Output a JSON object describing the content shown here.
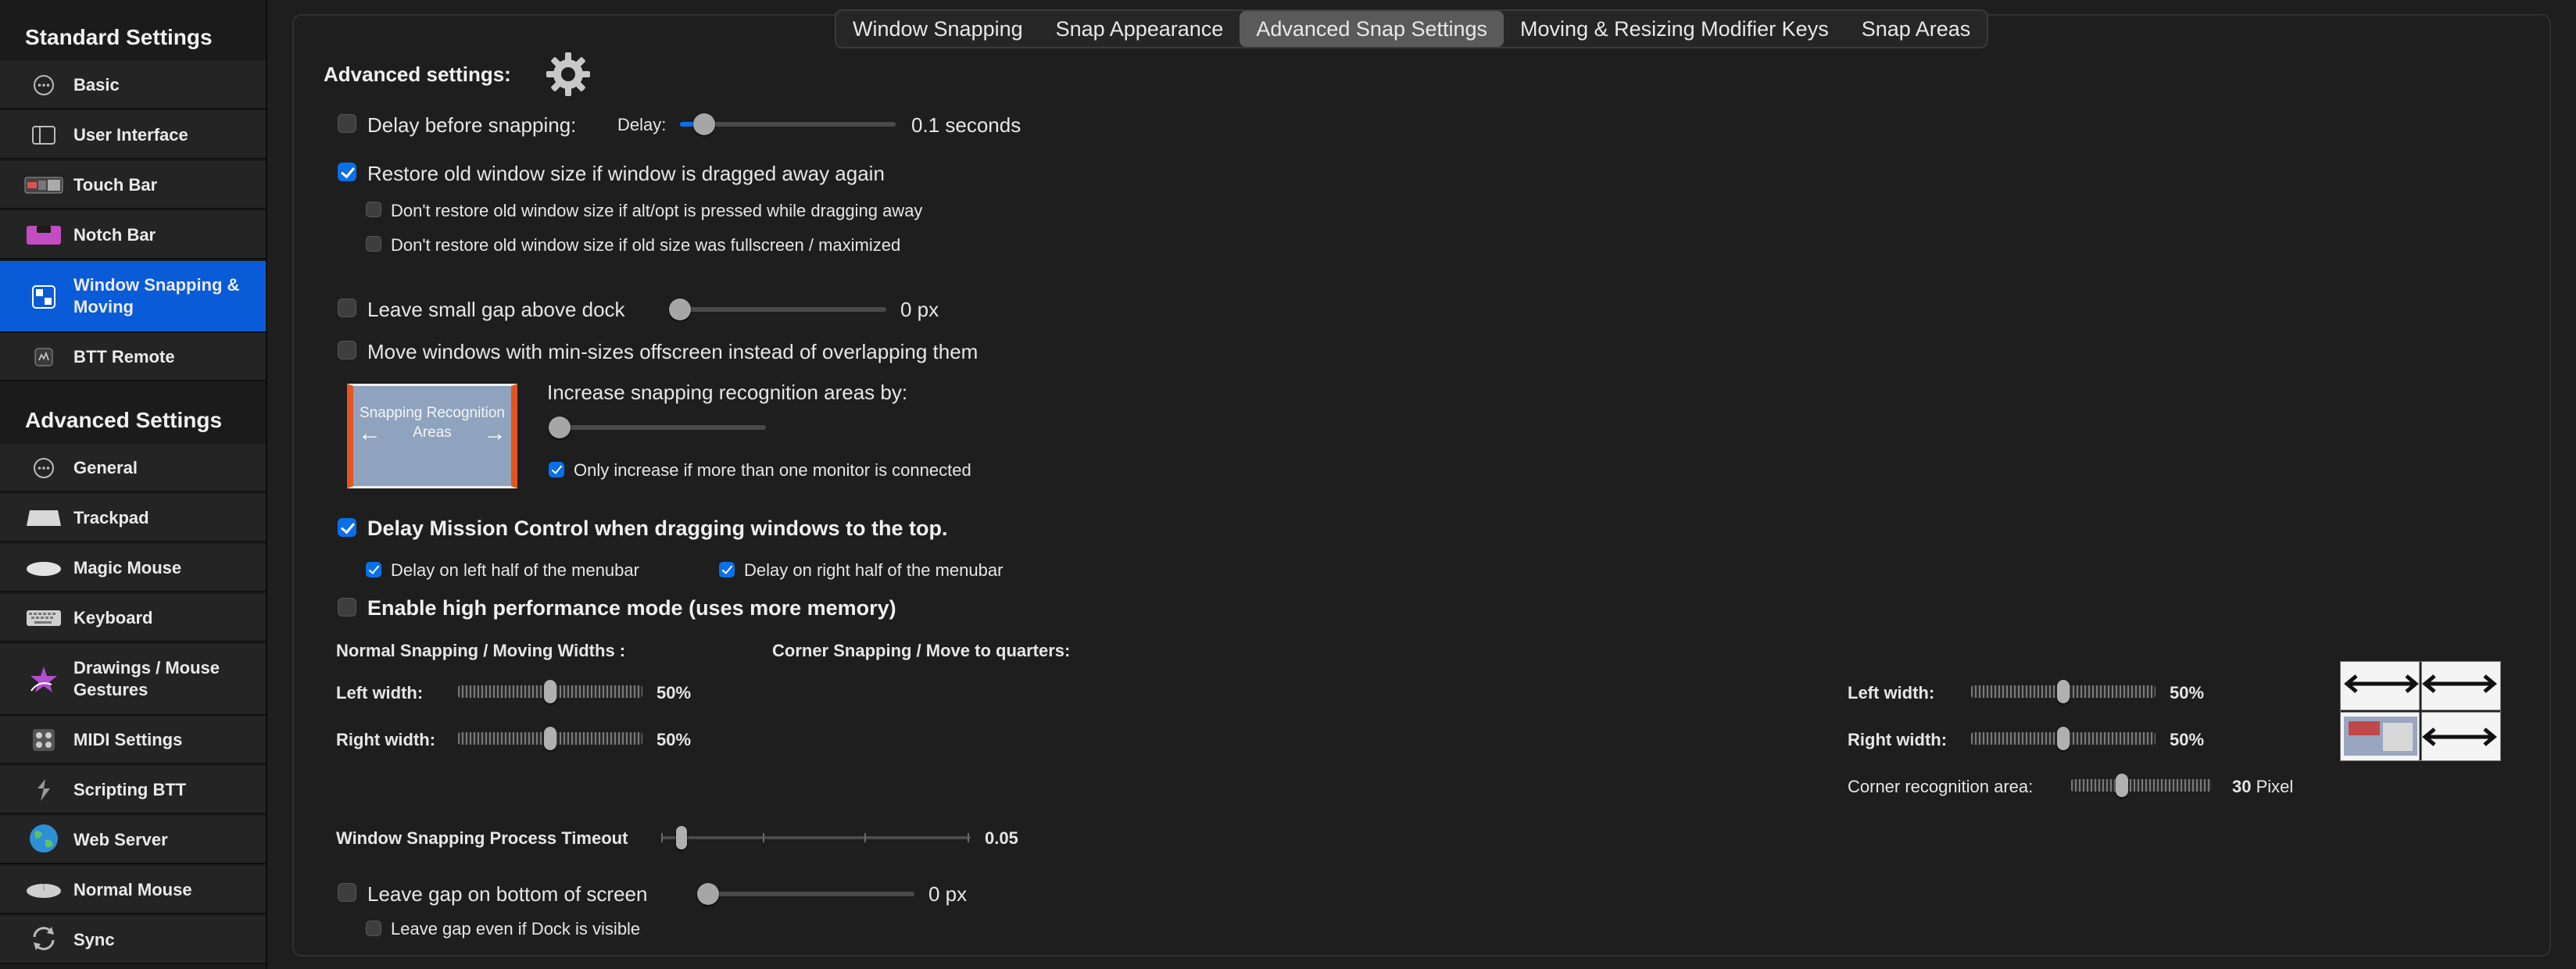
{
  "sidebar": {
    "standard_title": "Standard Settings",
    "standard_items": [
      {
        "label": "Basic",
        "icon": "ellipsis-circle-icon"
      },
      {
        "label": "User Interface",
        "icon": "window-sidebar-icon"
      },
      {
        "label": "Touch Bar",
        "icon": "touch-bar-icon"
      },
      {
        "label": "Notch Bar",
        "icon": "notch-bar-icon"
      },
      {
        "label": "Window Snapping & Moving",
        "icon": "window-snapping-icon",
        "selected": true
      },
      {
        "label": "BTT Remote",
        "icon": "remote-icon"
      }
    ],
    "advanced_title": "Advanced Settings",
    "advanced_items": [
      {
        "label": "General",
        "icon": "ellipsis-circle-icon"
      },
      {
        "label": "Trackpad",
        "icon": "trackpad-icon"
      },
      {
        "label": "Magic Mouse",
        "icon": "magic-mouse-icon"
      },
      {
        "label": "Keyboard",
        "icon": "keyboard-icon"
      },
      {
        "label": "Drawings / Mouse Gestures",
        "icon": "star-gesture-icon"
      },
      {
        "label": "MIDI Settings",
        "icon": "midi-icon"
      },
      {
        "label": "Scripting BTT",
        "icon": "scripting-icon"
      },
      {
        "label": "Web Server",
        "icon": "globe-icon"
      },
      {
        "label": "Normal Mouse",
        "icon": "mouse-icon"
      },
      {
        "label": "Sync",
        "icon": "sync-icon"
      }
    ]
  },
  "tabs": [
    {
      "label": "Window Snapping"
    },
    {
      "label": "Snap Appearance"
    },
    {
      "label": "Advanced Snap Settings",
      "active": true
    },
    {
      "label": "Moving & Resizing Modifier Keys"
    },
    {
      "label": "Snap Areas"
    }
  ],
  "advanced": {
    "title": "Advanced settings:",
    "delay": {
      "label": "Delay before snapping:",
      "checked": false,
      "slider_label": "Delay:",
      "value_text": "0.1 seconds",
      "fraction": 0.07
    },
    "restore": {
      "label": "Restore old window size if window is dragged away again",
      "checked": true
    },
    "no_restore_alt": {
      "label": "Don't restore old window size if alt/opt is pressed while dragging away",
      "checked": false
    },
    "no_restore_full": {
      "label": "Don't restore old window size if old size was fullscreen / maximized",
      "checked": false
    },
    "gap_dock": {
      "label": "Leave small gap above dock",
      "checked": false,
      "value_text": "0 px",
      "fraction": 0.0
    },
    "min_sizes": {
      "label": "Move windows with min-sizes offscreen instead of overlapping them",
      "checked": false
    },
    "recognition": {
      "label": "Increase snapping recognition areas by:",
      "fraction": 0.0,
      "image_text": "Snapping Recognition Areas",
      "only_multi": {
        "label": "Only increase if more than one monitor is connected",
        "checked": true
      }
    },
    "mission_control": {
      "label": "Delay Mission Control when dragging windows to the top.",
      "checked": true,
      "left_half": {
        "label": "Delay on left half of the menubar",
        "checked": true
      },
      "right_half": {
        "label": "Delay on right half of the menubar",
        "checked": true
      }
    },
    "high_perf": {
      "label": "Enable high performance mode (uses more memory)",
      "checked": false
    },
    "normal_widths": {
      "title": "Normal Snapping / Moving Widths :",
      "left": {
        "label": "Left width:",
        "value_text": "50%",
        "fraction": 0.5
      },
      "right": {
        "label": "Right width:",
        "value_text": "50%",
        "fraction": 0.5
      }
    },
    "corner": {
      "title": "Corner Snapping / Move to quarters:",
      "left": {
        "label": "Left width:",
        "value_text": "50%",
        "fraction": 0.5
      },
      "right": {
        "label": "Right width:",
        "value_text": "50%",
        "fraction": 0.5
      },
      "area": {
        "label": "Corner recognition area:",
        "value": "30",
        "unit": "Pixel",
        "fraction": 0.35
      }
    },
    "timeout": {
      "label": "Window Snapping Process Timeout",
      "value_text": "0.05",
      "fraction": 0.05
    },
    "gap_bottom": {
      "label": "Leave gap on bottom of screen",
      "checked": false,
      "value_text": "0 px",
      "fraction": 0.0,
      "dock_visible": {
        "label": "Leave gap even if Dock is visible",
        "checked": false
      }
    }
  },
  "colors": {
    "accent": "#0a6fe8",
    "selection": "#0a5bd8",
    "recognition_edge": "#e4541e"
  }
}
